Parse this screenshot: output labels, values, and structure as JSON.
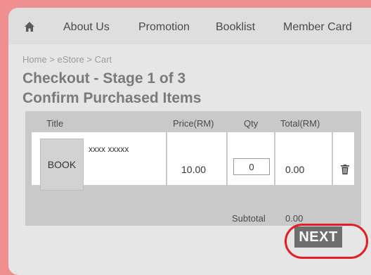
{
  "nav": {
    "items": [
      {
        "label": "About Us"
      },
      {
        "label": "Promotion"
      },
      {
        "label": "Booklist"
      },
      {
        "label": "Member Card"
      }
    ]
  },
  "breadcrumb": "Home > eStore > Cart",
  "page": {
    "title_line1": "Checkout - Stage 1 of 3",
    "title_line2": "Confirm Purchased Items"
  },
  "table": {
    "headers": {
      "title": "Title",
      "price": "Price(RM)",
      "qty": "Qty",
      "total": "Total(RM)"
    },
    "rows": [
      {
        "thumb": "BOOK",
        "name": "xxxx xxxxx",
        "price": "10.00",
        "qty": "0",
        "total": "0.00"
      }
    ],
    "subtotal_label": "Subtotal",
    "subtotal_value": "0.00"
  },
  "actions": {
    "next_label": "NEXT"
  },
  "colors": {
    "background": "#ef8f8f",
    "highlight": "#e31e24",
    "button": "#6e6e6e"
  },
  "icons": {
    "home": "home-icon",
    "delete": "trash-icon"
  }
}
